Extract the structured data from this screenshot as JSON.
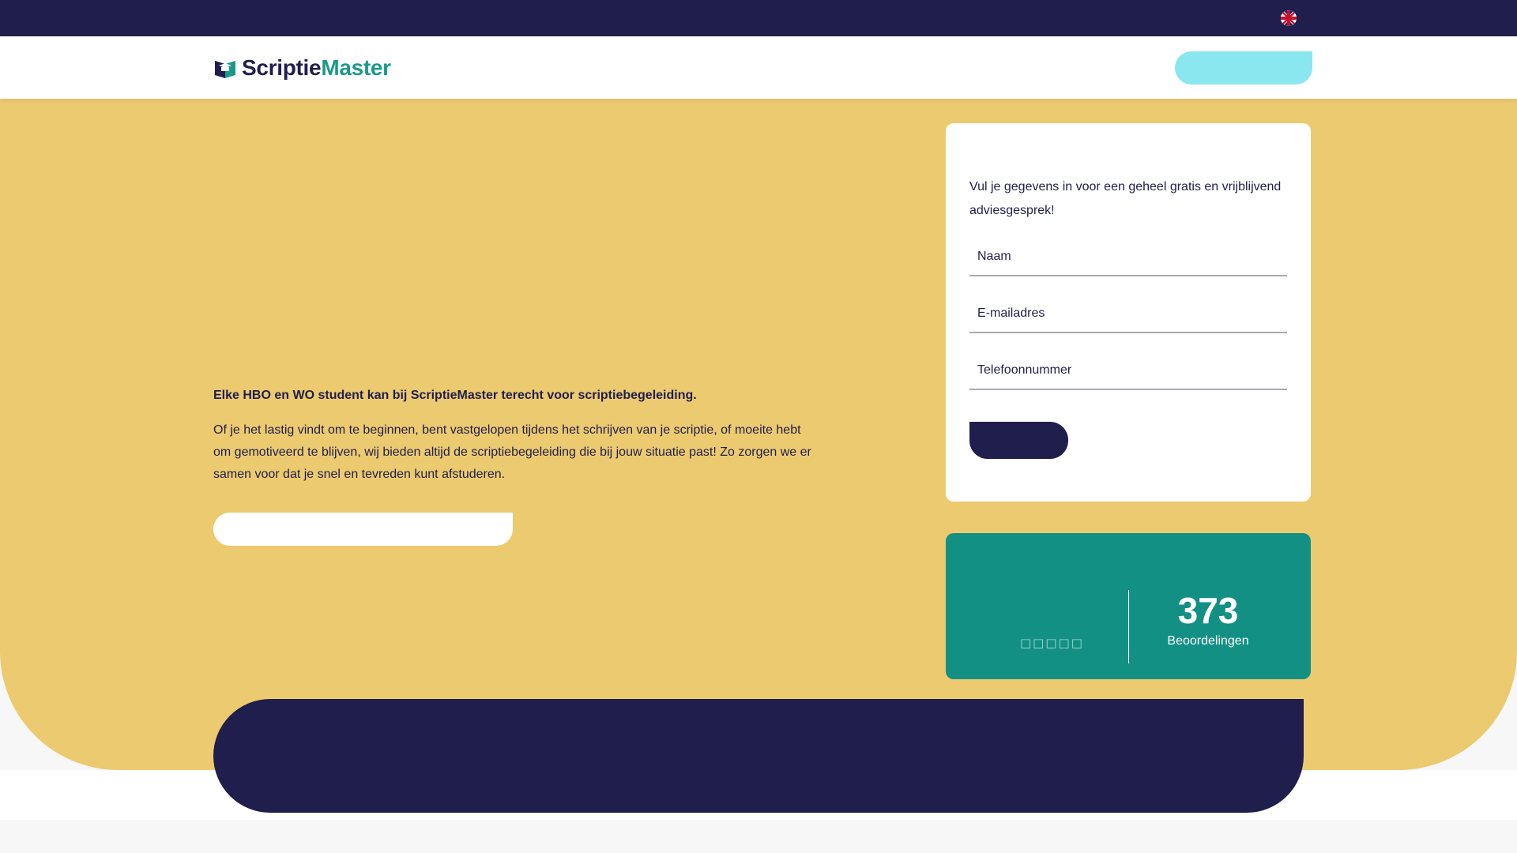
{
  "topbar": {
    "language_icon": "uk-flag-icon"
  },
  "header": {
    "logo_part1": "Scriptie",
    "logo_part2": "Master",
    "logo_icon": "graduation-cap-icon"
  },
  "hero": {
    "heading": "Elke HBO en WO student kan bij ScriptieMaster terecht voor scriptiebegeleiding.",
    "body": "Of je het lastig vindt om te beginnen, bent vastgelopen tijdens het schrijven van je scriptie, of moeite hebt om gemotiveerd te blijven, wij bieden altijd de scriptiebegeleiding die bij jouw situatie past! Zo zorgen we er samen voor dat je snel en tevreden kunt afstuderen."
  },
  "form": {
    "intro": "Vul je gegevens in voor een geheel gratis en vrijblijvend adviesgesprek!",
    "name_placeholder": "Naam",
    "email_placeholder": "E-mailadres",
    "phone_placeholder": "Telefoonnummer"
  },
  "rating": {
    "stars": "□□□□□",
    "count": "373",
    "label": "Beoordelingen"
  },
  "colors": {
    "navy": "#201e4c",
    "yellow": "#ecca70",
    "teal": "#139084",
    "cyan": "#8ae7f0"
  }
}
